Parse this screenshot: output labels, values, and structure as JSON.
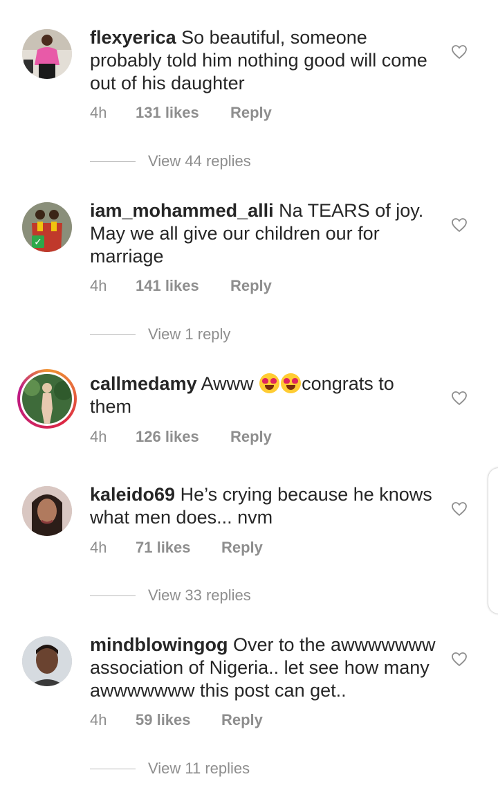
{
  "comments": [
    {
      "username": "flexyerica",
      "text": "So beautiful, someone probably told him nothing good will come out of his daughter",
      "time": "4h",
      "likes": "131 likes",
      "reply": "Reply",
      "view_replies": "View 44 replies"
    },
    {
      "username": "iam_mohammed_alli",
      "text": "Na TEARS of joy. May we all give our children our  for marriage",
      "time": "4h",
      "likes": "141 likes",
      "reply": "Reply",
      "view_replies": "View 1 reply"
    },
    {
      "username": "callmedamy",
      "text_before": "Awww",
      "text_after": "congrats to them",
      "time": "4h",
      "likes": "126 likes",
      "reply": "Reply"
    },
    {
      "username": "kaleido69",
      "text": "He’s crying because he knows what men does... nvm",
      "time": "4h",
      "likes": "71 likes",
      "reply": "Reply",
      "view_replies": "View 33 replies"
    },
    {
      "username": "mindblowingog",
      "text": "Over to the awwwwwww association of Nigeria.. let see how many awwwwwww this post can get..",
      "time": "4h",
      "likes": "59 likes",
      "reply": "Reply",
      "view_replies": "View 11 replies"
    }
  ],
  "colors": {
    "text": "#262626",
    "secondary": "#8e8e8e",
    "story_ring": "#dc2743"
  },
  "icons": [
    "heart-icon",
    "heart-eyes-emoji",
    "verified-check-icon"
  ]
}
